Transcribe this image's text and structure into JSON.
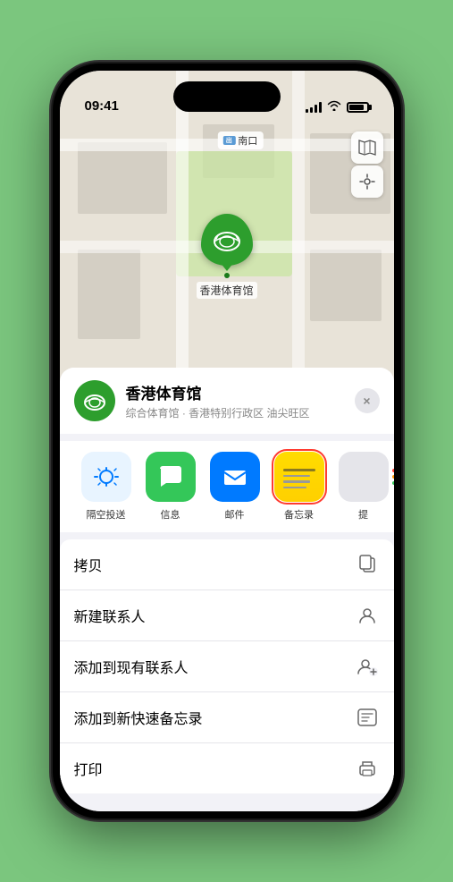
{
  "status_bar": {
    "time": "09:41",
    "location_arrow": "▶"
  },
  "map": {
    "label_icon": "出",
    "label_text": "南口",
    "marker_name": "香港体育馆"
  },
  "venue_card": {
    "name": "香港体育馆",
    "subtitle": "综合体育馆 · 香港特别行政区 油尖旺区",
    "close_label": "×"
  },
  "share_row": {
    "items": [
      {
        "id": "airdrop",
        "label": "隔空投送",
        "type": "airdrop"
      },
      {
        "id": "messages",
        "label": "信息",
        "type": "messages"
      },
      {
        "id": "mail",
        "label": "邮件",
        "type": "mail"
      },
      {
        "id": "notes",
        "label": "备忘录",
        "type": "notes",
        "selected": true
      },
      {
        "id": "more",
        "label": "提",
        "type": "more"
      }
    ]
  },
  "actions": [
    {
      "id": "copy",
      "label": "拷贝",
      "icon": "copy"
    },
    {
      "id": "new-contact",
      "label": "新建联系人",
      "icon": "person"
    },
    {
      "id": "add-contact",
      "label": "添加到现有联系人",
      "icon": "person-add"
    },
    {
      "id": "add-notes",
      "label": "添加到新快速备忘录",
      "icon": "note"
    },
    {
      "id": "print",
      "label": "打印",
      "icon": "print"
    }
  ]
}
